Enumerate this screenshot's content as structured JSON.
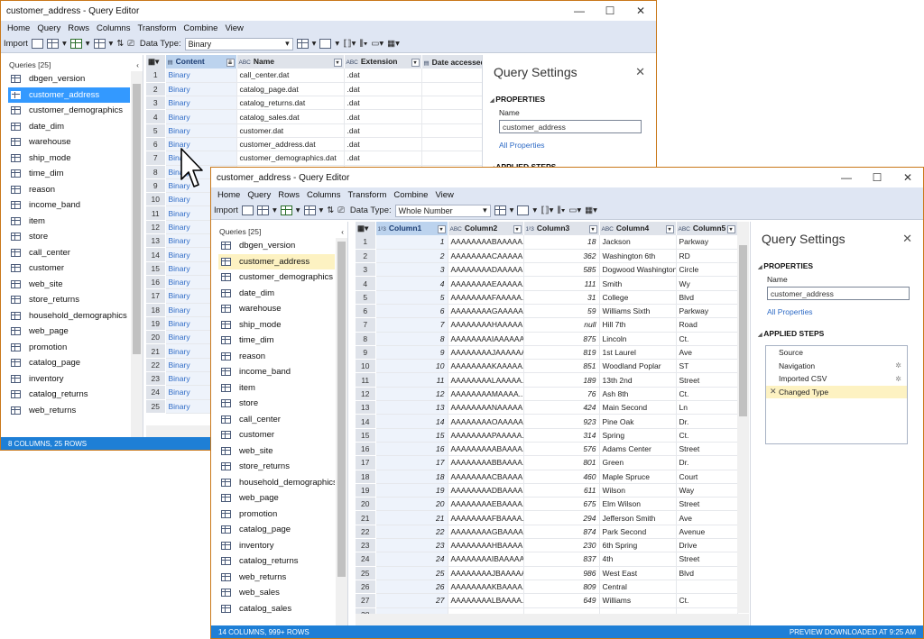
{
  "back_window": {
    "title": "customer_address - Query Editor",
    "menu": [
      "Home",
      "Query",
      "Rows",
      "Columns",
      "Transform",
      "Combine",
      "View"
    ],
    "toolbar": {
      "import_label": "Import",
      "data_type_label": "Data Type:",
      "data_type_value": "Binary"
    },
    "queries_header": "Queries [25]",
    "queries": [
      "dbgen_version",
      "customer_address",
      "customer_demographics",
      "date_dim",
      "warehouse",
      "ship_mode",
      "time_dim",
      "reason",
      "income_band",
      "item",
      "store",
      "call_center",
      "customer",
      "web_site",
      "store_returns",
      "household_demographics",
      "web_page",
      "promotion",
      "catalog_page",
      "inventory",
      "catalog_returns",
      "web_returns"
    ],
    "selected_query": "customer_address",
    "columns": [
      "Content",
      "Name",
      "Extension",
      "Date accessed"
    ],
    "rows": [
      [
        "1",
        "Binary",
        "call_center.dat",
        ".dat"
      ],
      [
        "2",
        "Binary",
        "catalog_page.dat",
        ".dat"
      ],
      [
        "3",
        "Binary",
        "catalog_returns.dat",
        ".dat"
      ],
      [
        "4",
        "Binary",
        "catalog_sales.dat",
        ".dat"
      ],
      [
        "5",
        "Binary",
        "customer.dat",
        ".dat"
      ],
      [
        "6",
        "Binary",
        "customer_address.dat",
        ".dat"
      ],
      [
        "7",
        "Binary",
        "customer_demographics.dat",
        ".dat"
      ],
      [
        "8",
        "Binary",
        "",
        ""
      ],
      [
        "9",
        "Binary",
        "",
        ""
      ],
      [
        "10",
        "Binary",
        "",
        ""
      ],
      [
        "11",
        "Binary",
        "",
        ""
      ],
      [
        "12",
        "Binary",
        "",
        ""
      ],
      [
        "13",
        "Binary",
        "",
        ""
      ],
      [
        "14",
        "Binary",
        "",
        ""
      ],
      [
        "15",
        "Binary",
        "",
        ""
      ],
      [
        "16",
        "Binary",
        "",
        ""
      ],
      [
        "17",
        "Binary",
        "",
        ""
      ],
      [
        "18",
        "Binary",
        "",
        ""
      ],
      [
        "19",
        "Binary",
        "",
        ""
      ],
      [
        "20",
        "Binary",
        "",
        ""
      ],
      [
        "21",
        "Binary",
        "",
        ""
      ],
      [
        "22",
        "Binary",
        "",
        ""
      ],
      [
        "23",
        "Binary",
        "",
        ""
      ],
      [
        "24",
        "Binary",
        "",
        ""
      ],
      [
        "25",
        "Binary",
        "",
        ""
      ]
    ],
    "settings": {
      "title": "Query Settings",
      "properties": "PROPERTIES",
      "name_label": "Name",
      "name_value": "customer_address",
      "all_properties": "All Properties",
      "applied_steps": "APPLIED STEPS"
    },
    "status": "8 COLUMNS, 25 ROWS"
  },
  "front_window": {
    "title": "customer_address - Query Editor",
    "menu": [
      "Home",
      "Query",
      "Rows",
      "Columns",
      "Transform",
      "Combine",
      "View"
    ],
    "toolbar": {
      "import_label": "Import",
      "data_type_label": "Data Type:",
      "data_type_value": "Whole Number"
    },
    "queries_header": "Queries [25]",
    "queries": [
      "dbgen_version",
      "customer_address",
      "customer_demographics",
      "date_dim",
      "warehouse",
      "ship_mode",
      "time_dim",
      "reason",
      "income_band",
      "item",
      "store",
      "call_center",
      "customer",
      "web_site",
      "store_returns",
      "household_demographics",
      "web_page",
      "promotion",
      "catalog_page",
      "inventory",
      "catalog_returns",
      "web_returns",
      "web_sales",
      "catalog_sales"
    ],
    "selected_query": "customer_address",
    "columns": [
      "Column1",
      "Column2",
      "Column3",
      "Column4",
      "Column5"
    ],
    "rows": [
      [
        "1",
        "1",
        "AAAAAAAABAAAAA...",
        "18",
        "Jackson",
        "Parkway"
      ],
      [
        "2",
        "2",
        "AAAAAAAACAAAAA...",
        "362",
        "Washington 6th",
        "RD"
      ],
      [
        "3",
        "3",
        "AAAAAAAADAAAAA...",
        "585",
        "Dogwood Washington",
        "Circle"
      ],
      [
        "4",
        "4",
        "AAAAAAAAEAAAAA...",
        "111",
        "Smith",
        "Wy"
      ],
      [
        "5",
        "5",
        "AAAAAAAAFAAAAA...",
        "31",
        "College",
        "Blvd"
      ],
      [
        "6",
        "6",
        "AAAAAAAAGAAAAA...",
        "59",
        "Williams Sixth",
        "Parkway"
      ],
      [
        "7",
        "7",
        "AAAAAAAAHAAAAA...",
        "null",
        "Hill 7th",
        "Road"
      ],
      [
        "8",
        "8",
        "AAAAAAAAIAAAAAAA",
        "875",
        "Lincoln",
        "Ct."
      ],
      [
        "9",
        "9",
        "AAAAAAAAJAAAAAAA",
        "819",
        "1st Laurel",
        "Ave"
      ],
      [
        "10",
        "10",
        "AAAAAAAAKAAAAA...",
        "851",
        "Woodland Poplar",
        "ST"
      ],
      [
        "11",
        "11",
        "AAAAAAAALAAAAA...",
        "189",
        "13th 2nd",
        "Street"
      ],
      [
        "12",
        "12",
        "AAAAAAAAMAAAA...",
        "76",
        "Ash 8th",
        "Ct."
      ],
      [
        "13",
        "13",
        "AAAAAAAANAAAAA...",
        "424",
        "Main Second",
        "Ln"
      ],
      [
        "14",
        "14",
        "AAAAAAAAOAAAAA...",
        "923",
        "Pine Oak",
        "Dr."
      ],
      [
        "15",
        "15",
        "AAAAAAAAPAAAAA...",
        "314",
        "Spring",
        "Ct."
      ],
      [
        "16",
        "16",
        "AAAAAAAAABAAAA...",
        "576",
        "Adams Center",
        "Street"
      ],
      [
        "17",
        "17",
        "AAAAAAAABBAAAA...",
        "801",
        "Green",
        "Dr."
      ],
      [
        "18",
        "18",
        "AAAAAAAACBAAAA...",
        "460",
        "Maple Spruce",
        "Court"
      ],
      [
        "19",
        "19",
        "AAAAAAAADBAAAA...",
        "611",
        "Wilson",
        "Way"
      ],
      [
        "20",
        "20",
        "AAAAAAAAEBAAAA...",
        "675",
        "Elm Wilson",
        "Street"
      ],
      [
        "21",
        "21",
        "AAAAAAAAFBAAAA...",
        "294",
        "Jefferson Smith",
        "Ave"
      ],
      [
        "22",
        "22",
        "AAAAAAAAGBAAAA...",
        "874",
        "Park Second",
        "Avenue"
      ],
      [
        "23",
        "23",
        "AAAAAAAAHBAAAA...",
        "230",
        "6th Spring",
        "Drive"
      ],
      [
        "24",
        "24",
        "AAAAAAAAIBAAAAAA",
        "837",
        "4th",
        "Street"
      ],
      [
        "25",
        "25",
        "AAAAAAAAJBAAAAAA",
        "986",
        "West East",
        "Blvd"
      ],
      [
        "26",
        "26",
        "AAAAAAAAKBAAAA...",
        "809",
        "Central",
        ""
      ],
      [
        "27",
        "27",
        "AAAAAAAALBAAAA...",
        "649",
        "Williams",
        "Ct."
      ],
      [
        "28",
        "",
        "",
        "",
        "",
        ""
      ]
    ],
    "settings": {
      "title": "Query Settings",
      "properties": "PROPERTIES",
      "name_label": "Name",
      "name_value": "customer_address",
      "all_properties": "All Properties",
      "applied_steps": "APPLIED STEPS",
      "steps": [
        "Source",
        "Navigation",
        "Imported CSV",
        "Changed Type"
      ]
    },
    "status_left": "14 COLUMNS, 999+ ROWS",
    "status_right": "PREVIEW DOWNLOADED AT 9:25 AM"
  },
  "colors": {
    "accent": "#1e7fd6",
    "border": "#c9781a",
    "selected": "#3399ff",
    "step_selected": "#fdf2c2"
  }
}
